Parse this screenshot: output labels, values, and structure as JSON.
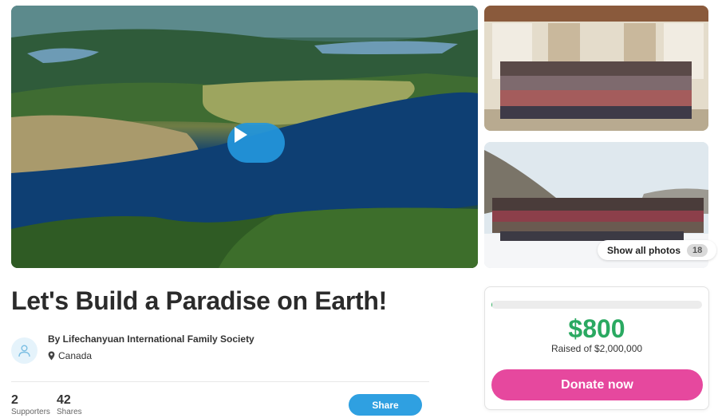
{
  "campaign": {
    "title": "Let's Build a Paradise on Earth!",
    "organizer": "By Lifechanyuan International Family Society",
    "location": "Canada"
  },
  "media": {
    "hero_kind": "video",
    "play_icon": "play-icon",
    "show_all_label": "Show all photos",
    "photo_count": "18"
  },
  "stats": {
    "supporters_value": "2",
    "supporters_label": "Supporters",
    "shares_value": "42",
    "shares_label": "Shares"
  },
  "actions": {
    "share_label": "Share",
    "donate_label": "Donate now"
  },
  "donation": {
    "raised_amount": "$800",
    "goal_text": "Raised of $2,000,000",
    "progress_fraction": 0.0004
  },
  "colors": {
    "accent_blue": "#2fa0e1",
    "donate_pink": "#e6489e",
    "amount_green": "#2aa961"
  }
}
